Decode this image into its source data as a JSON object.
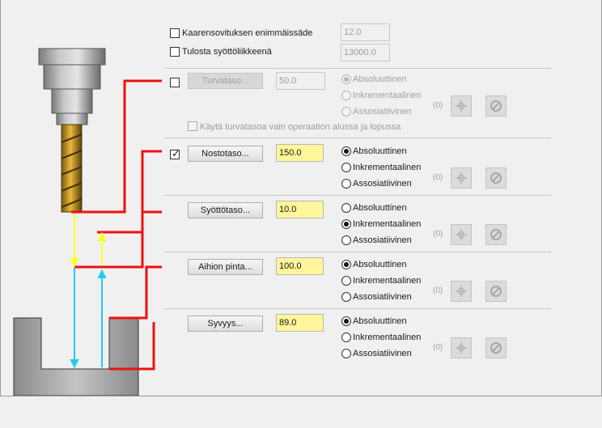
{
  "options": {
    "arc_fit_radius": {
      "label": "Kaarensovituksen enimmäissäde",
      "value": "12.0",
      "checked": false
    },
    "output_feed": {
      "label": "Tulosta syöttöliikkeenä",
      "value": "13000.0",
      "checked": false
    }
  },
  "radio_labels": {
    "absolute": "Absoluuttinen",
    "incremental": "Inkrementaalinen",
    "associative": "Assosiatiivinen"
  },
  "associative_count": "(0)",
  "sections": {
    "clearance": {
      "button": "Turvataso...",
      "value": "50.0",
      "checked": false,
      "enabled": false,
      "selected": "absolute",
      "only_start_end_label": "Käytä turvatasoa vain operaation alussa ja lopussa"
    },
    "retract": {
      "button": "Nostotaso...",
      "value": "150.0",
      "checked": true,
      "enabled": true,
      "selected": "absolute"
    },
    "feed": {
      "button": "Syöttötaso...",
      "value": "10.0",
      "enabled": true,
      "selected": "incremental"
    },
    "stock_top": {
      "button": "Aihion pinta...",
      "value": "100.0",
      "enabled": true,
      "selected": "absolute"
    },
    "depth": {
      "button": "Syvyys...",
      "value": "89.0",
      "enabled": true,
      "selected": "absolute"
    }
  },
  "icons": {
    "pick_icon": "crosshair-pick-icon",
    "clear_icon": "clear-selection-icon"
  },
  "colors": {
    "field_yellow": "#fff59a",
    "guide_red": "#ee1111",
    "feed_yellow": "#ffff22",
    "move_cyan": "#22ccee"
  }
}
